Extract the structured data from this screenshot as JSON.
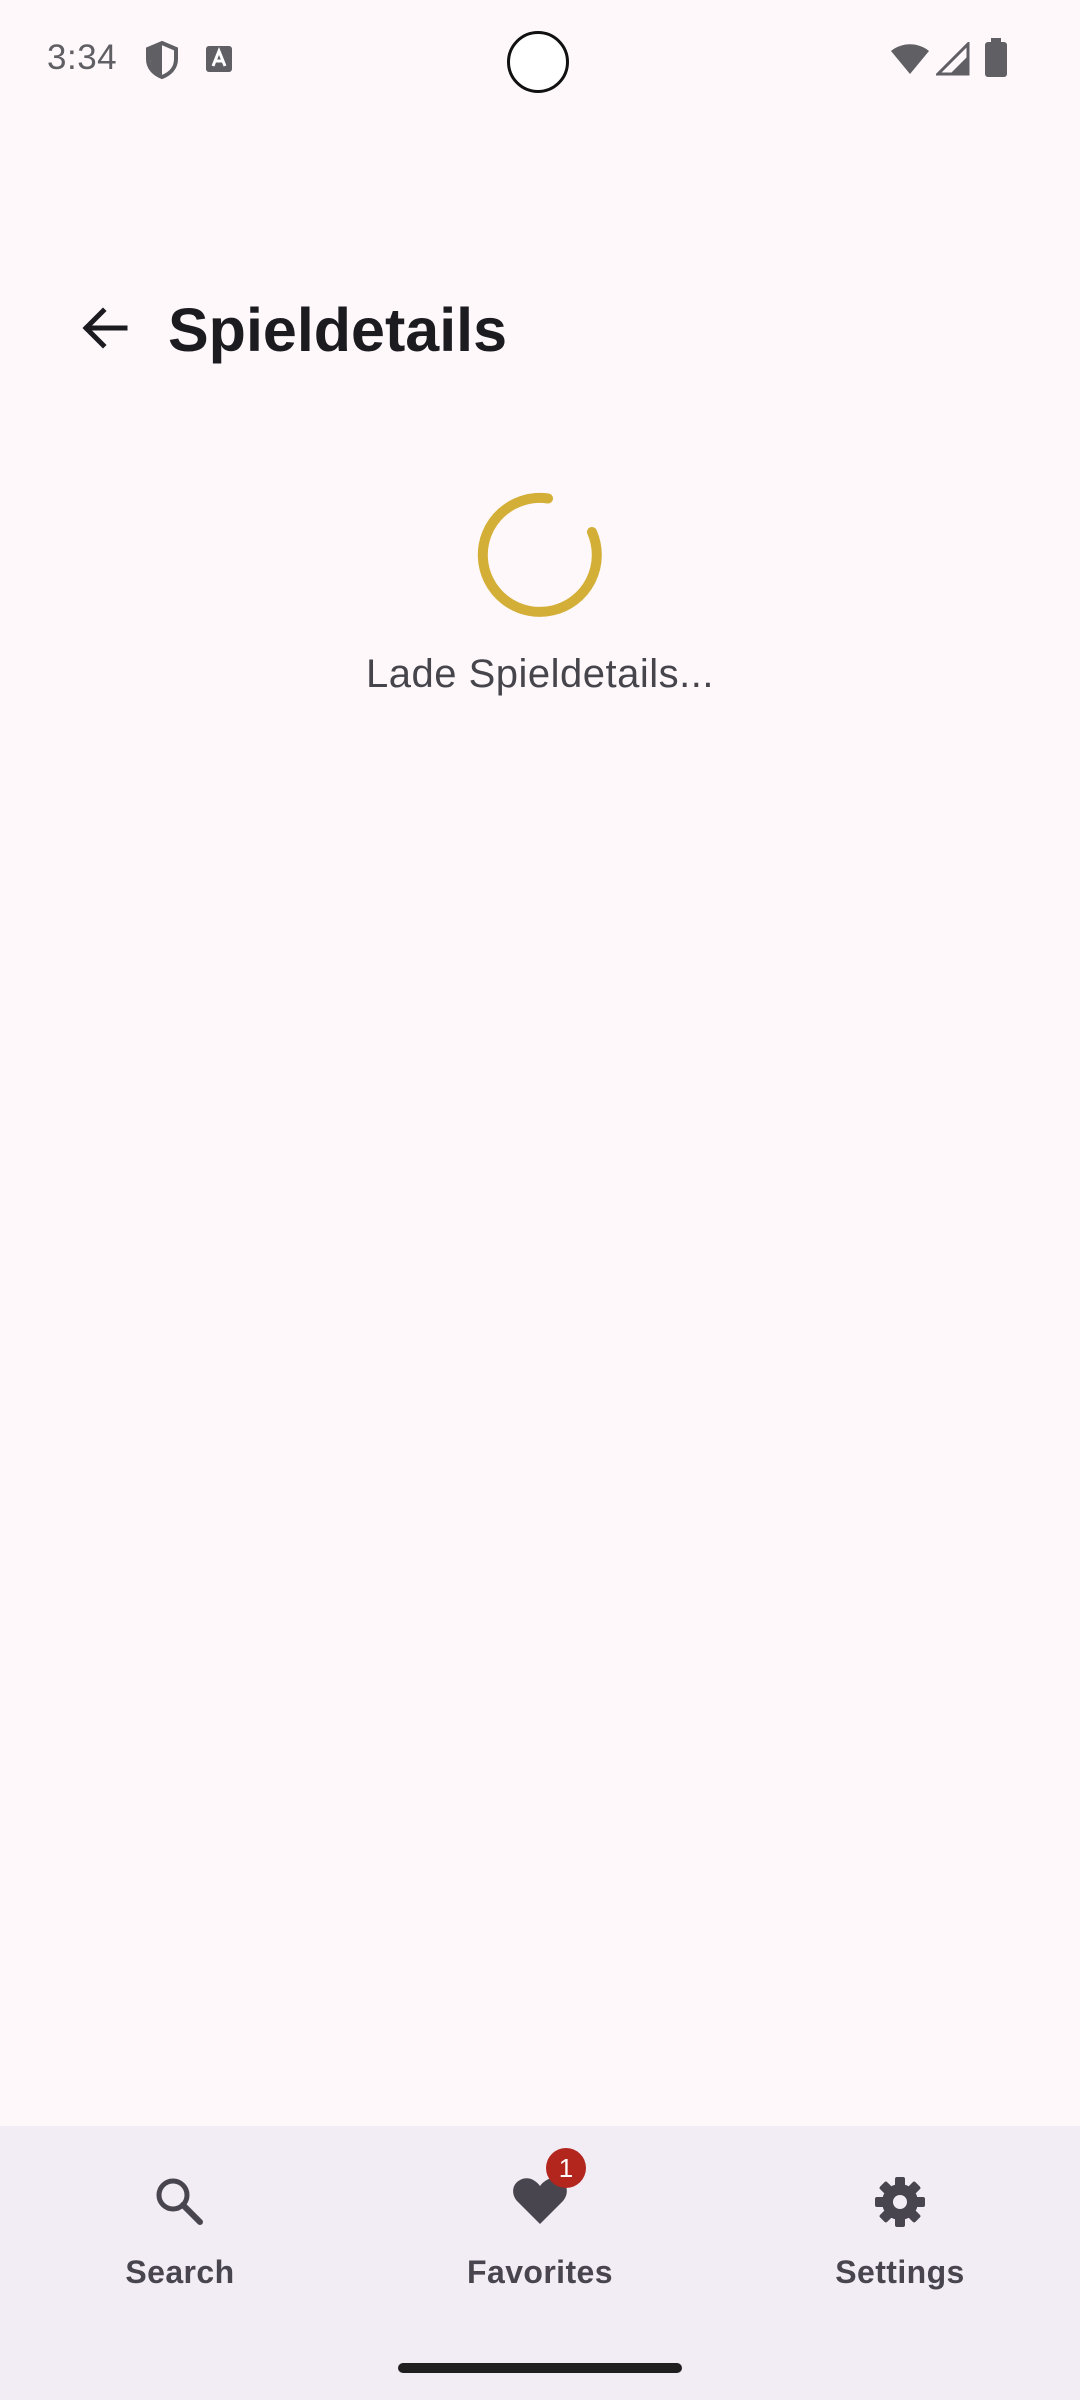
{
  "status_bar": {
    "time": "3:34",
    "icons": [
      "shield-icon",
      "text-a-icon",
      "wifi-icon",
      "cell-signal-icon",
      "battery-icon"
    ]
  },
  "app_bar": {
    "title": "Spieldetails",
    "back_icon": "arrow-back-icon"
  },
  "loading": {
    "text": "Lade Spieldetails...",
    "spinner_color": "#d4af37"
  },
  "bottom_nav": {
    "items": [
      {
        "label": "Search",
        "icon": "search-icon"
      },
      {
        "label": "Favorites",
        "icon": "heart-icon",
        "badge": "1"
      },
      {
        "label": "Settings",
        "icon": "gear-icon"
      }
    ]
  },
  "colors": {
    "background": "#fef8fb",
    "nav_background": "#f2ecf4",
    "badge": "#b3261e",
    "accent": "#d4af37"
  }
}
